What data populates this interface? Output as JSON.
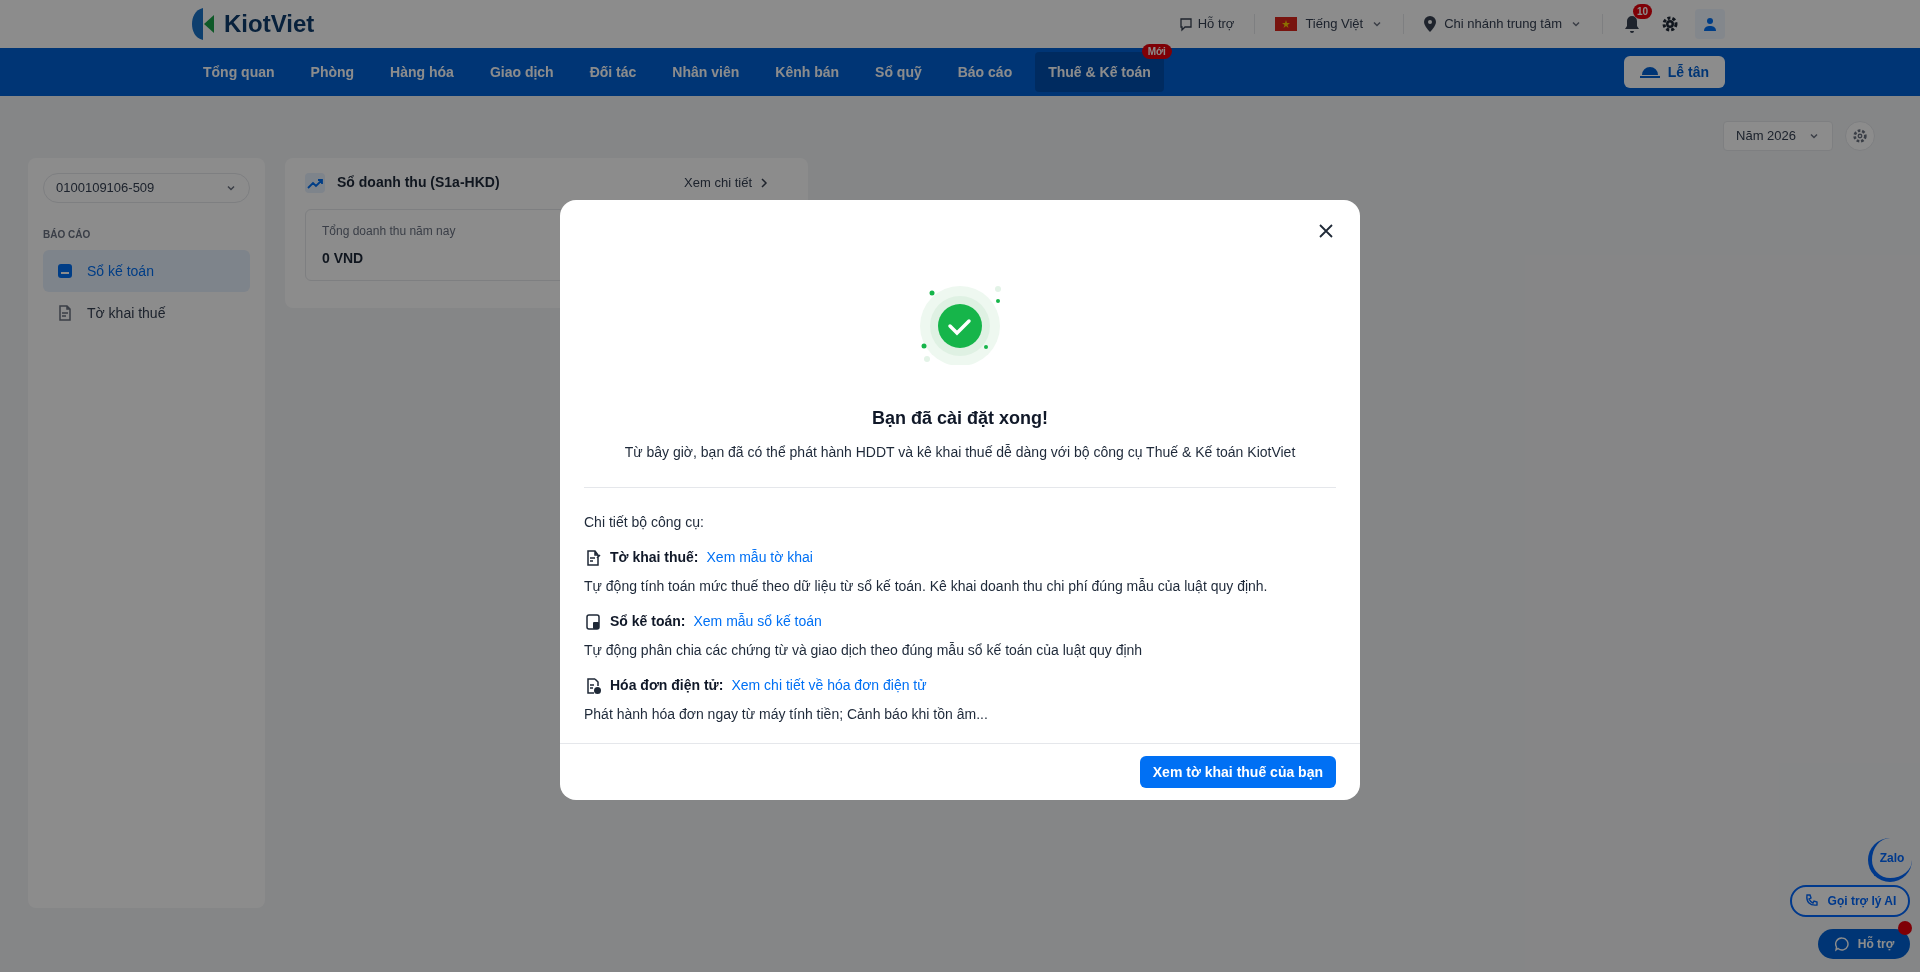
{
  "header": {
    "logo": "KiotViet",
    "support": "Hỗ trợ",
    "language": "Tiếng Việt",
    "branch": "Chi nhánh trung tâm",
    "notification_count": "10"
  },
  "nav": {
    "items": [
      {
        "label": "Tổng quan",
        "selected": false
      },
      {
        "label": "Phòng",
        "selected": false
      },
      {
        "label": "Hàng hóa",
        "selected": false
      },
      {
        "label": "Giao dịch",
        "selected": false
      },
      {
        "label": "Đối tác",
        "selected": false
      },
      {
        "label": "Nhân viên",
        "selected": false
      },
      {
        "label": "Kênh bán",
        "selected": false
      },
      {
        "label": "Sổ quỹ",
        "selected": false
      },
      {
        "label": "Báo cáo",
        "selected": false
      },
      {
        "label": "Thuế & Kế toán",
        "selected": true,
        "badge": "Mới"
      }
    ],
    "reception_button": "Lễ tân"
  },
  "year_select": "Năm 2026",
  "sidebar": {
    "tax_code": "0100109106-509",
    "section": "BÁO CÁO",
    "items": [
      {
        "label": "Sổ kế toán",
        "kind": "book",
        "selected": true
      },
      {
        "label": "Tờ khai thuế",
        "kind": "form",
        "selected": false
      }
    ]
  },
  "revenue_card": {
    "title": "Sổ doanh thu (S1a-HKD)",
    "link": "Xem chi tiết",
    "stat_label": "Tổng doanh thu năm nay",
    "stat_value": "0 VND"
  },
  "floating": {
    "zalo": "Zalo",
    "ai_call": "Gọi trợ lý AI",
    "support": "Hỗ trợ"
  },
  "modal": {
    "title": "Bạn đã cài đặt xong!",
    "subtitle": "Từ bây giờ, bạn đã có thể phát hành HDDT và kê khai thuế dễ dàng với bộ công cụ Thuế & Kế toán KiotViet",
    "details_heading": "Chi tiết bộ công cụ:",
    "tools": [
      {
        "kind": "form",
        "name": "Tờ khai thuế:",
        "link": "Xem mẫu tờ khai",
        "description": "Tự động tính toán mức thuế theo dữ liệu từ sổ kế toán. Kê khai doanh thu chi phí đúng mẫu của luật quy định."
      },
      {
        "kind": "book",
        "name": "Sổ kế toán:",
        "link": "Xem mẫu sổ kế toán",
        "description": "Tự động phân chia các chứng từ và giao dịch theo đúng mẫu sổ kế toán của luật quy định"
      },
      {
        "kind": "invoice",
        "name": "Hóa đơn điện tử:",
        "link": "Xem chi tiết về hóa đơn điện tử",
        "description": "Phát hành hóa đơn ngay từ máy tính tiền; Cảnh báo khi tồn âm..."
      }
    ],
    "primary_button": "Xem tờ khai thuế của bạn"
  }
}
